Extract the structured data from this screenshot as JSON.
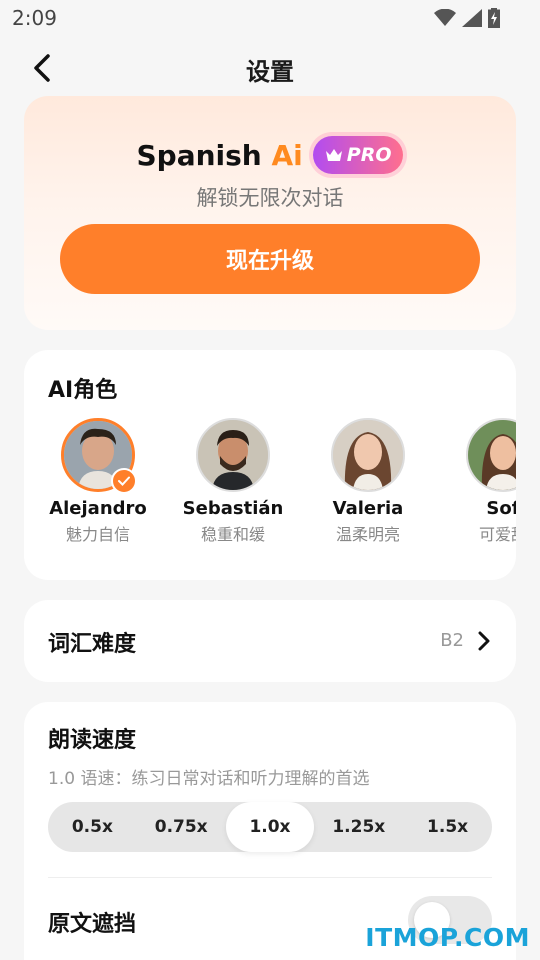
{
  "status_bar": {
    "time": "2:09",
    "icons": [
      "wifi-icon",
      "cellular-signal-icon",
      "battery-charging-icon"
    ]
  },
  "nav": {
    "title": "设置",
    "back_icon": "chevron-left-icon"
  },
  "promo": {
    "brand_prefix": "Spanish ",
    "brand_accent": "Ai",
    "pro_label": "PRO",
    "subtitle": "解锁无限次对话",
    "upgrade_label": "现在升级",
    "accent_color": "#ff7f2a"
  },
  "roles": {
    "title": "AI角色",
    "items": [
      {
        "name": "Alejandro",
        "desc": "魅力自信",
        "selected": true
      },
      {
        "name": "Sebastián",
        "desc": "稳重和缓",
        "selected": false
      },
      {
        "name": "Valeria",
        "desc": "温柔明亮",
        "selected": false
      },
      {
        "name": "Sof",
        "desc": "可爱甜",
        "selected": false
      }
    ]
  },
  "vocab": {
    "title": "词汇难度",
    "value": "B2"
  },
  "speed": {
    "title": "朗读速度",
    "description": "1.0 语速：练习日常对话和听力理解的首选",
    "options": [
      "0.5x",
      "0.75x",
      "1.0x",
      "1.25x",
      "1.5x"
    ],
    "selected": "1.0x"
  },
  "mask": {
    "title": "原文遮挡",
    "enabled": false
  },
  "watermark": "ITMOP.COM"
}
